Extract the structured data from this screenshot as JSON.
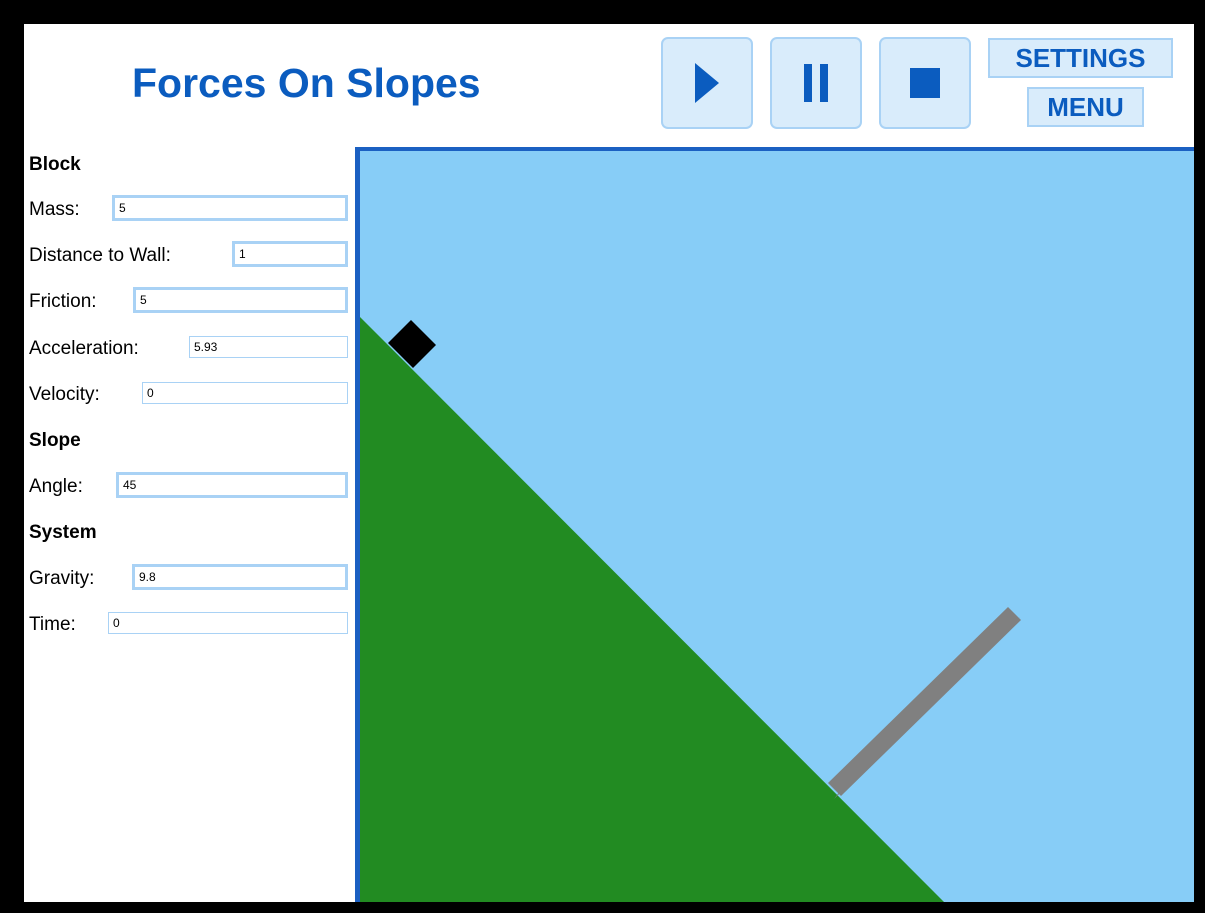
{
  "header": {
    "title": "Forces On Slopes",
    "controls": {
      "play_icon": "play-icon",
      "pause_icon": "pause-icon",
      "stop_icon": "stop-icon",
      "settings_label": "SETTINGS",
      "menu_label": "MENU"
    }
  },
  "panel": {
    "block": {
      "heading": "Block",
      "mass": {
        "label": "Mass:",
        "value": "5"
      },
      "distance_to_wall": {
        "label": "Distance to Wall:",
        "value": "1"
      },
      "friction": {
        "label": "Friction:",
        "value": "5"
      },
      "acceleration": {
        "label": "Acceleration:",
        "value": "5.93"
      },
      "velocity": {
        "label": "Velocity:",
        "value": "0"
      }
    },
    "slope": {
      "heading": "Slope",
      "angle": {
        "label": "Angle:",
        "value": "45"
      }
    },
    "system": {
      "heading": "System",
      "gravity": {
        "label": "Gravity:",
        "value": "9.8"
      },
      "time": {
        "label": "Time:",
        "value": "0"
      }
    }
  },
  "simulation": {
    "slope_angle_deg": 45,
    "colors": {
      "sky": "#87cdf7",
      "ground": "#228b22",
      "block": "#000000",
      "wall": "#808080",
      "frame": "#1b60c2"
    }
  },
  "colors": {
    "accent": "#0b5cbf",
    "button_fill": "#d9ecfb",
    "button_border": "#a9d2f5"
  }
}
